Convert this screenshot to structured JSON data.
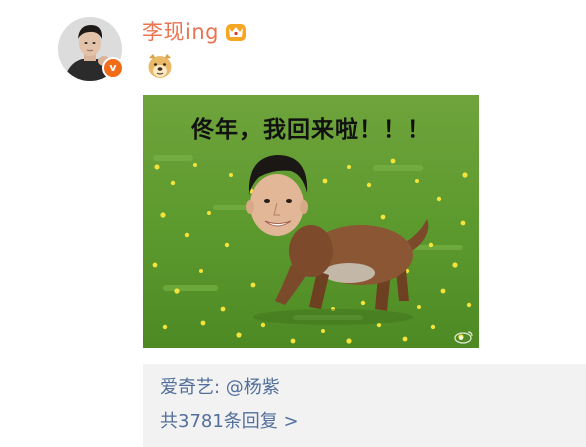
{
  "post": {
    "username": "李现ing",
    "member_icon": "vip-crown-icon",
    "verified_badge": "v",
    "emoji": "doge-emoji",
    "colors": {
      "username": "#eb7350",
      "badge": "#f26b18",
      "link": "#526e9b",
      "reply_bg": "#f2f2f2"
    }
  },
  "meme": {
    "caption": "佟年，我回来啦！！！"
  },
  "replies": {
    "first_reply": "爱奇艺: @杨紫",
    "more_replies": "共3781条回复 >"
  }
}
